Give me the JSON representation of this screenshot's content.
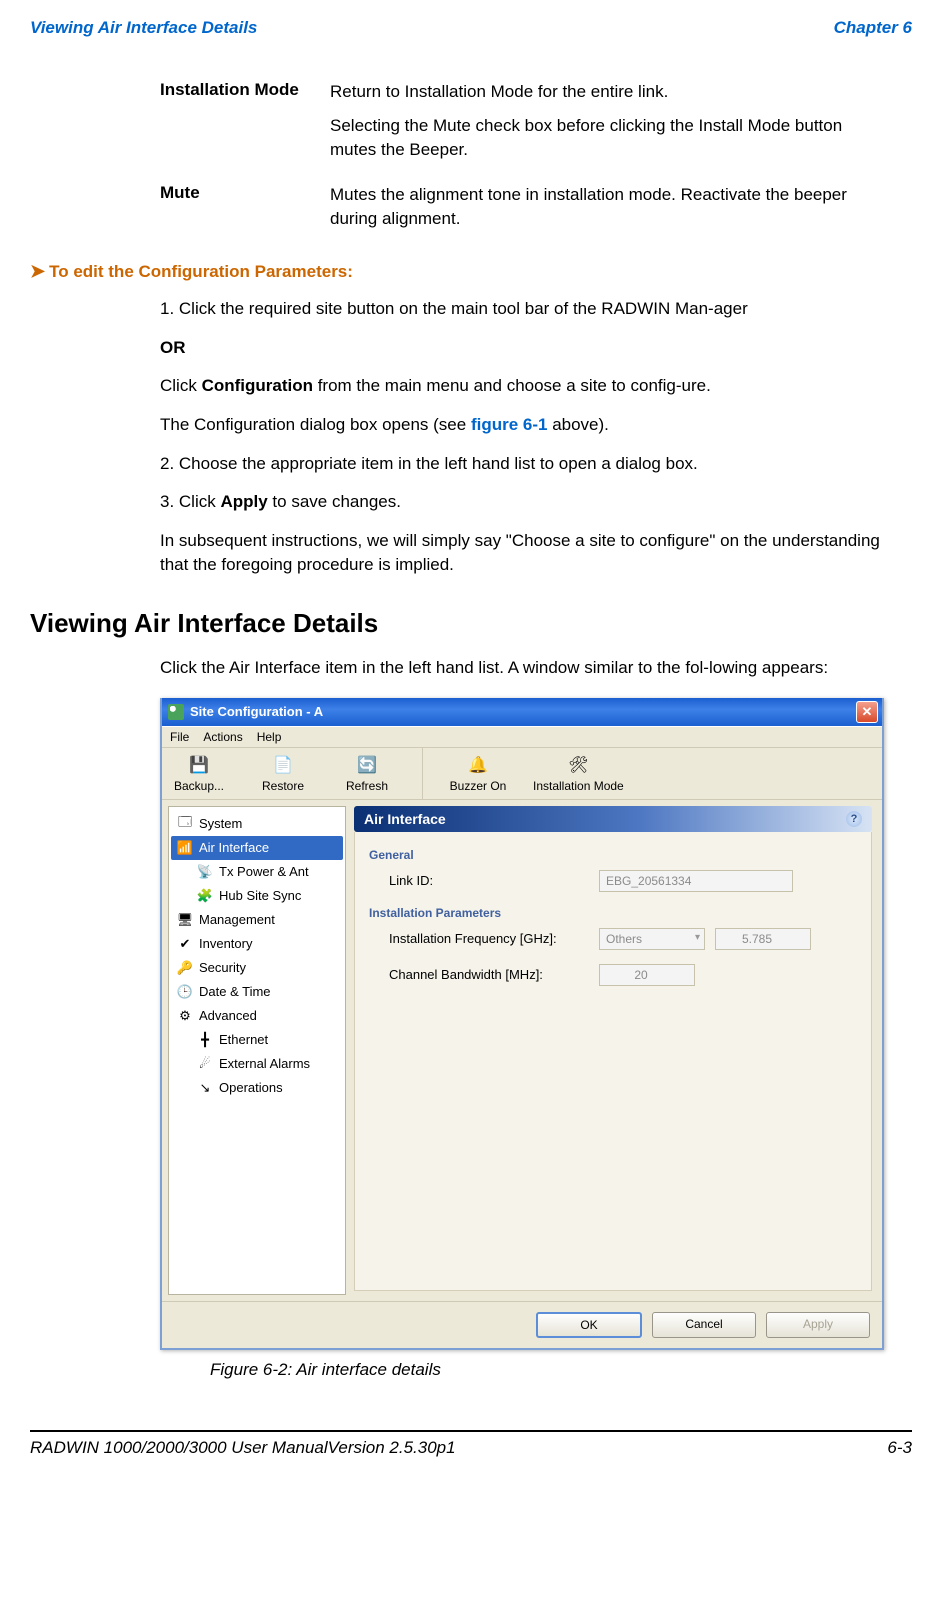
{
  "header": {
    "left": "Viewing Air Interface Details",
    "right": "Chapter 6"
  },
  "defs": {
    "install_mode": {
      "term": "Installation Mode",
      "p1": "Return to Installation Mode for the entire link.",
      "p2": "Selecting the Mute check box before clicking the Install Mode button mutes the Beeper."
    },
    "mute": {
      "term": "Mute",
      "p1": "Mutes the alignment tone in installation mode. Reactivate the beeper during alignment."
    }
  },
  "procedure": {
    "title": "To edit the Configuration Parameters:",
    "s1": "1. Click the required site button on the main tool bar of the RADWIN Man-ager",
    "or": "OR",
    "s1b_pre": "Click ",
    "s1b_bold": "Configuration",
    "s1b_post": " from the main menu and choose a site to config-ure.",
    "s1c_pre": "The Configuration dialog box opens (see ",
    "s1c_link": "figure 6-1",
    "s1c_post": " above).",
    "s2": "2. Choose the appropriate item in the left hand list to open a dialog box.",
    "s3_pre": "3. Click ",
    "s3_bold": "Apply",
    "s3_post": " to save changes.",
    "tail": "In subsequent instructions, we will simply say \"Choose a site to configure\" on the understanding that the foregoing procedure is implied."
  },
  "section_heading": "Viewing Air Interface Details",
  "section_intro": "Click the Air Interface item in the left hand list. A window similar to the fol-lowing appears:",
  "fig_caption": "Figure 6-2: Air interface details",
  "footer": {
    "left": "RADWIN 1000/2000/3000 User ManualVersion  2.5.30p1",
    "right": "6-3"
  },
  "window": {
    "title": "Site Configuration - A",
    "menu": {
      "file": "File",
      "actions": "Actions",
      "help": "Help"
    },
    "toolbar": {
      "backup": {
        "label": "Backup...",
        "icon": "💾"
      },
      "restore": {
        "label": "Restore",
        "icon": "📄"
      },
      "refresh": {
        "label": "Refresh",
        "icon": "🔄"
      },
      "buzzer": {
        "label": "Buzzer On",
        "icon": "🔔"
      },
      "install": {
        "label": "Installation Mode",
        "icon": "🛠"
      }
    },
    "sidebar": {
      "system": {
        "label": "System",
        "icon": "🗔"
      },
      "air": {
        "label": "Air Interface",
        "icon": "📶"
      },
      "txpower": {
        "label": "Tx Power & Ant",
        "icon": "📡"
      },
      "hubsync": {
        "label": "Hub Site Sync",
        "icon": "🧩"
      },
      "management": {
        "label": "Management",
        "icon": "🖥"
      },
      "inventory": {
        "label": "Inventory",
        "icon": "✔"
      },
      "security": {
        "label": "Security",
        "icon": "🔑"
      },
      "datetime": {
        "label": "Date & Time",
        "icon": "🕒"
      },
      "advanced": {
        "label": "Advanced",
        "icon": "⚙"
      },
      "ethernet": {
        "label": "Ethernet",
        "icon": "╋"
      },
      "extalarms": {
        "label": "External Alarms",
        "icon": "☄"
      },
      "operations": {
        "label": "Operations",
        "icon": "↘"
      }
    },
    "pane": {
      "title": "Air Interface",
      "general_label": "General",
      "linkid_label": "Link ID:",
      "linkid_value": "EBG_20561334",
      "install_label": "Installation Parameters",
      "freq_label": "Installation Frequency [GHz]:",
      "freq_select": "Others",
      "freq_value": "5.785",
      "bw_label": "Channel Bandwidth [MHz]:",
      "bw_value": "20"
    },
    "buttons": {
      "ok": "OK",
      "cancel": "Cancel",
      "apply": "Apply"
    }
  }
}
